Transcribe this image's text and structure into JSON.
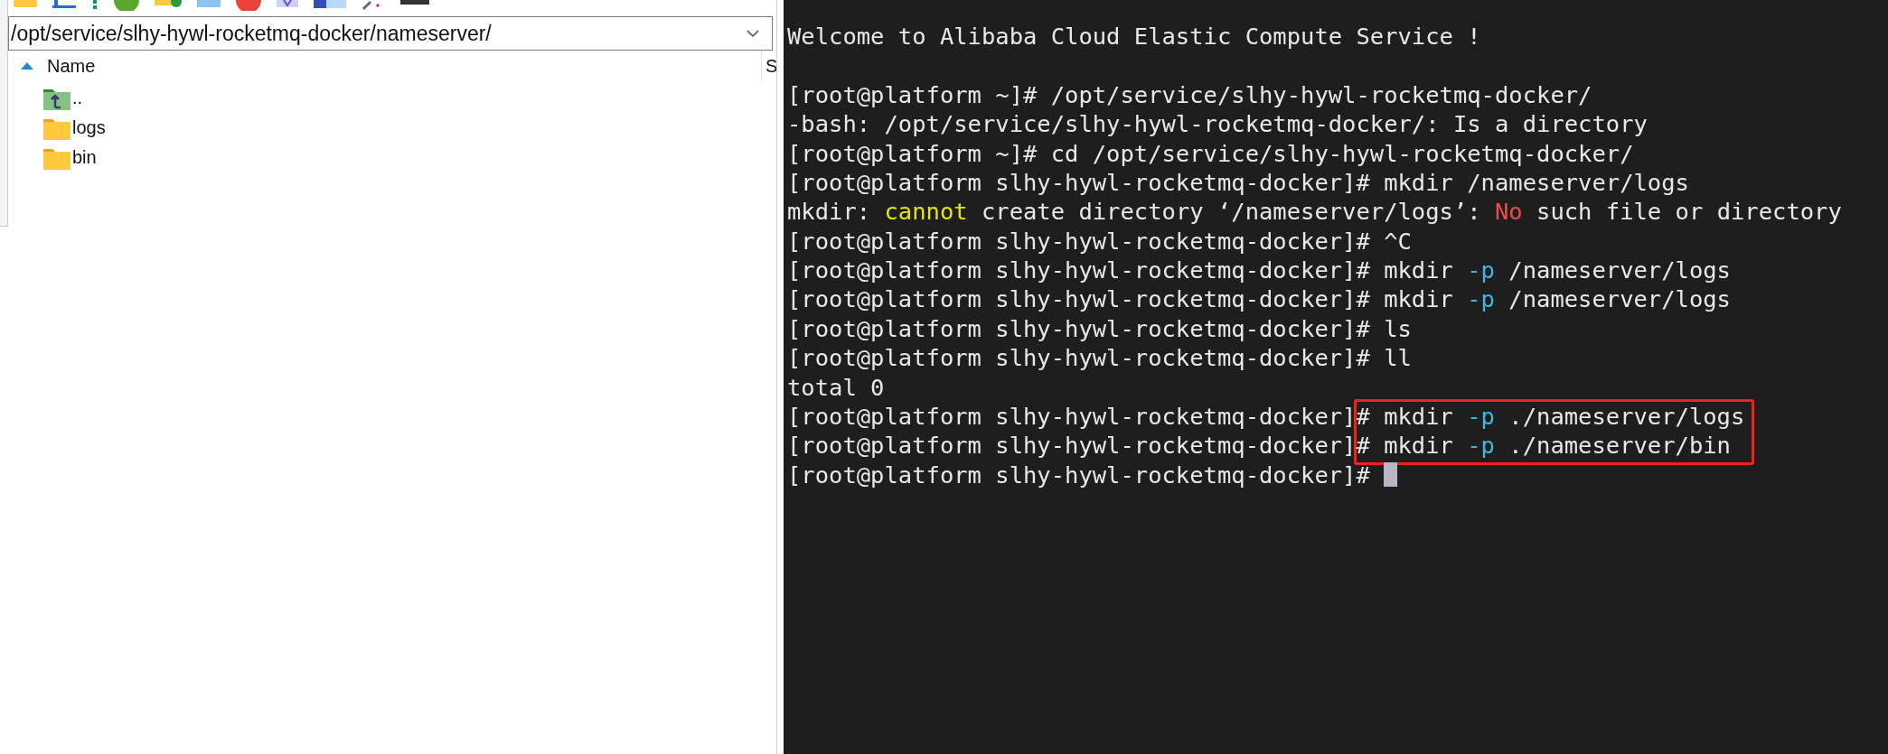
{
  "file_panel": {
    "path": "/opt/service/slhy-hywl-rocketmq-docker/nameserver/",
    "columns": [
      {
        "label": "Name",
        "sorted": true
      },
      {
        "label": "S",
        "sorted": false
      }
    ],
    "items": [
      {
        "name": "..",
        "kind": "parent"
      },
      {
        "name": "logs",
        "kind": "folder"
      },
      {
        "name": "bin",
        "kind": "folder"
      }
    ]
  },
  "terminal": {
    "lines": [
      {
        "kind": "text",
        "highlighted": false,
        "segments": [
          {
            "text": "Welcome to Alibaba Cloud Elastic Compute Service !",
            "color": "#e8e8e8"
          }
        ]
      },
      {
        "kind": "blank",
        "highlighted": false
      },
      {
        "kind": "text",
        "highlighted": false,
        "segments": [
          {
            "text": "[root@platform ~]# /opt/service/slhy-hywl-rocketmq-docker/",
            "color": "#e8e8e8"
          }
        ]
      },
      {
        "kind": "text",
        "highlighted": false,
        "segments": [
          {
            "text": "-bash: /opt/service/slhy-hywl-rocketmq-docker/: Is a directory",
            "color": "#e8e8e8"
          }
        ]
      },
      {
        "kind": "text",
        "highlighted": false,
        "segments": [
          {
            "text": "[root@platform ~]# cd /opt/service/slhy-hywl-rocketmq-docker/",
            "color": "#e8e8e8"
          }
        ]
      },
      {
        "kind": "text",
        "highlighted": false,
        "segments": [
          {
            "text": "[root@platform slhy-hywl-rocketmq-docker]# mkdir /nameserver/logs",
            "color": "#e8e8e8"
          }
        ]
      },
      {
        "kind": "text",
        "highlighted": false,
        "segments": [
          {
            "text": "mkdir: ",
            "color": "#e8e8e8"
          },
          {
            "text": "cannot",
            "color": "#e5e510"
          },
          {
            "text": " create directory ‘/nameserver/logs’: ",
            "color": "#e8e8e8"
          },
          {
            "text": "No",
            "color": "#f14c4c"
          },
          {
            "text": " such file or directory",
            "color": "#e8e8e8"
          }
        ]
      },
      {
        "kind": "text",
        "highlighted": false,
        "segments": [
          {
            "text": "[root@platform slhy-hywl-rocketmq-docker]# ^C",
            "color": "#e8e8e8"
          }
        ]
      },
      {
        "kind": "text",
        "highlighted": false,
        "segments": [
          {
            "text": "[root@platform slhy-hywl-rocketmq-docker]# mkdir ",
            "color": "#e8e8e8"
          },
          {
            "text": "-p",
            "color": "#3fb8e0"
          },
          {
            "text": " /nameserver/logs",
            "color": "#e8e8e8"
          }
        ]
      },
      {
        "kind": "text",
        "highlighted": false,
        "segments": [
          {
            "text": "[root@platform slhy-hywl-rocketmq-docker]# mkdir ",
            "color": "#e8e8e8"
          },
          {
            "text": "-p",
            "color": "#3fb8e0"
          },
          {
            "text": " /nameserver/logs",
            "color": "#e8e8e8"
          }
        ]
      },
      {
        "kind": "text",
        "highlighted": false,
        "segments": [
          {
            "text": "[root@platform slhy-hywl-rocketmq-docker]# ls",
            "color": "#e8e8e8"
          }
        ]
      },
      {
        "kind": "text",
        "highlighted": false,
        "segments": [
          {
            "text": "[root@platform slhy-hywl-rocketmq-docker]# ll",
            "color": "#e8e8e8"
          }
        ]
      },
      {
        "kind": "text",
        "highlighted": false,
        "segments": [
          {
            "text": "total 0",
            "color": "#e8e8e8"
          }
        ]
      },
      {
        "kind": "text",
        "highlighted": true,
        "segments": [
          {
            "text": "[root@platform slhy-hywl-rocketmq-docker]# mkdir ",
            "color": "#e8e8e8"
          },
          {
            "text": "-p",
            "color": "#3fb8e0"
          },
          {
            "text": " ./nameserver/logs",
            "color": "#e8e8e8"
          }
        ]
      },
      {
        "kind": "text",
        "highlighted": true,
        "segments": [
          {
            "text": "[root@platform slhy-hywl-rocketmq-docker]# mkdir ",
            "color": "#e8e8e8"
          },
          {
            "text": "-p",
            "color": "#3fb8e0"
          },
          {
            "text": " ./nameserver/bin",
            "color": "#e8e8e8"
          }
        ]
      },
      {
        "kind": "prompt",
        "highlighted": false,
        "segments": [
          {
            "text": "[root@platform slhy-hywl-rocketmq-docker]# ",
            "color": "#e8e8e8"
          }
        ]
      }
    ]
  }
}
